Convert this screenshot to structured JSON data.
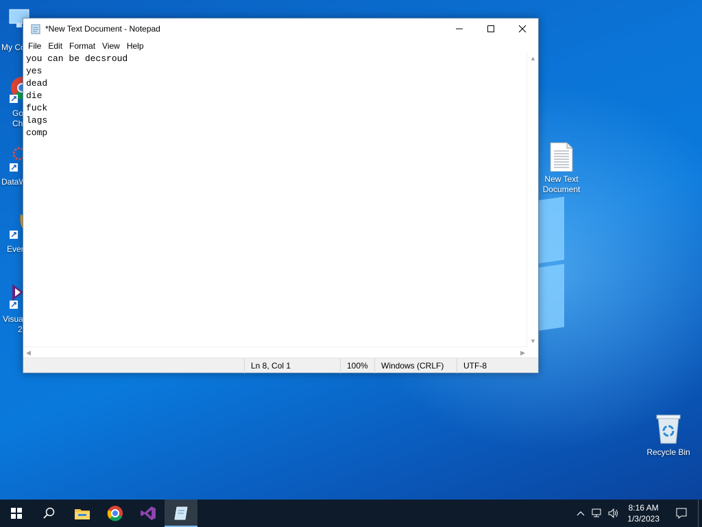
{
  "window": {
    "title": "*New Text Document - Notepad",
    "menus": [
      "File",
      "Edit",
      "Format",
      "View",
      "Help"
    ],
    "lines": [
      "you can be decsroud",
      "yes",
      "dead",
      "die",
      "fuck",
      "lags",
      "comp"
    ],
    "status": {
      "position": "Ln 8, Col 1",
      "zoom": "100%",
      "line_ending": "Windows (CRLF)",
      "encoding": "UTF-8"
    }
  },
  "desktop": {
    "left_icons": [
      {
        "label": "My Co",
        "icon": "this-pc-icon"
      },
      {
        "label": "Go",
        "label2": "Ch",
        "icon": "chrome-icon"
      },
      {
        "label": "DataW",
        "icon": "datawrapper-icon"
      },
      {
        "label": "Ever",
        "icon": "everything-icon"
      },
      {
        "label": "Visua",
        "label2": "2",
        "icon": "visual-studio-icon"
      }
    ],
    "text_doc_label": "New Text Document",
    "recycle_label": "Recycle Bin"
  },
  "taskbar": {
    "time": "8:16 AM",
    "date": "1/3/2023"
  },
  "colors": {
    "taskbar": "#0e1b2b",
    "accent": "#76b9ed",
    "desktop": "#0b74d6"
  }
}
